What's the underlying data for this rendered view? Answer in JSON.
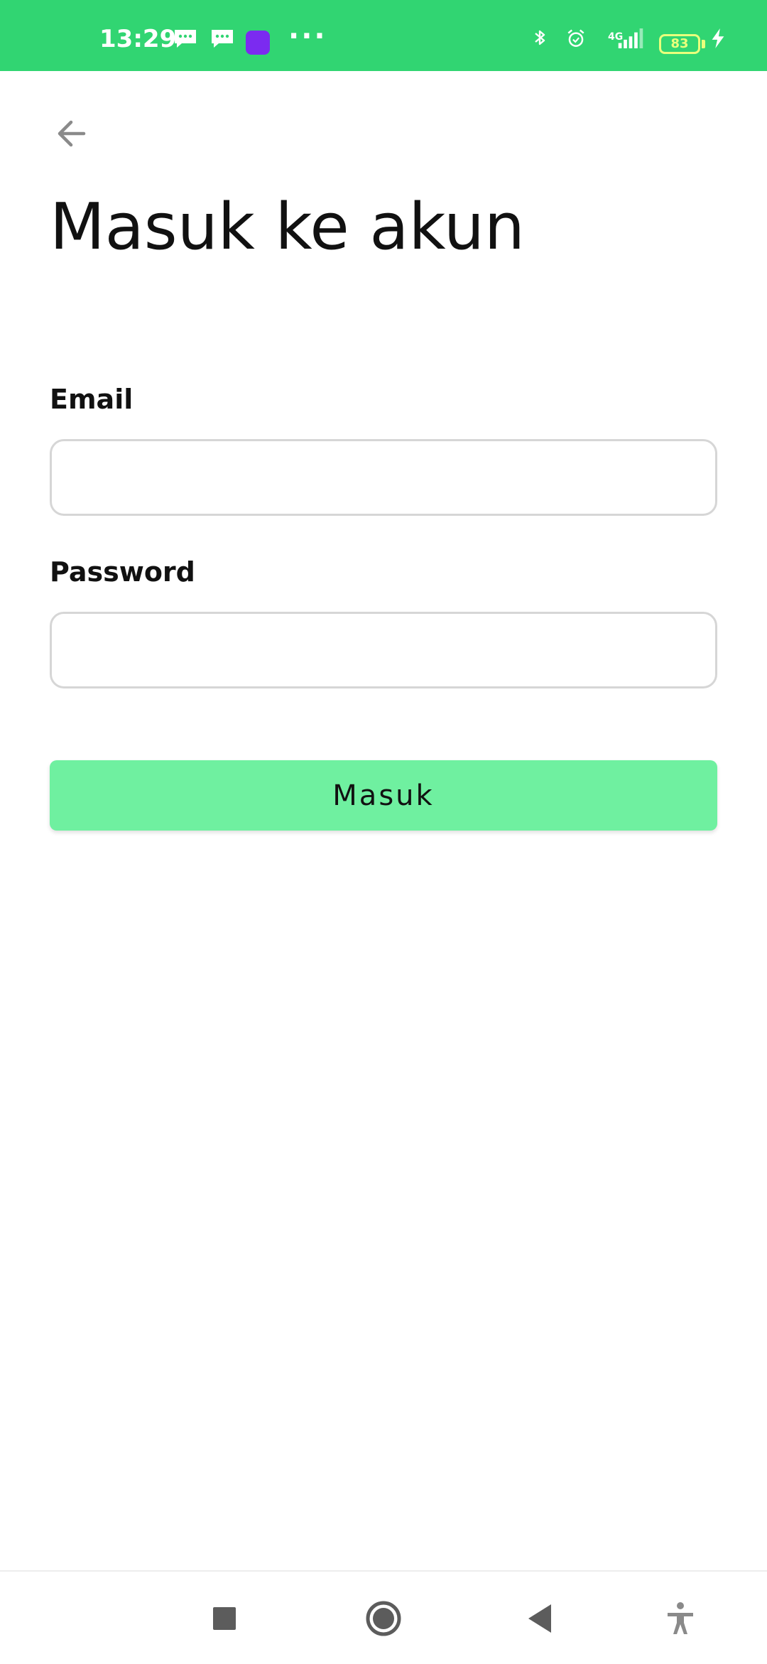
{
  "status_bar": {
    "time": "13:29",
    "network": "4G",
    "battery": "83",
    "accent_color": "#31d572"
  },
  "header": {
    "back_icon": "arrow-left-icon"
  },
  "page": {
    "title": "Masuk ke akun"
  },
  "form": {
    "email_label": "Email",
    "email_value": "",
    "password_label": "Password",
    "password_value": "",
    "submit_label": "Masuk",
    "submit_color": "#6ff0a0"
  },
  "nav_bar": {
    "icons": [
      "recent-apps-icon",
      "home-icon",
      "back-icon",
      "accessibility-icon"
    ]
  }
}
